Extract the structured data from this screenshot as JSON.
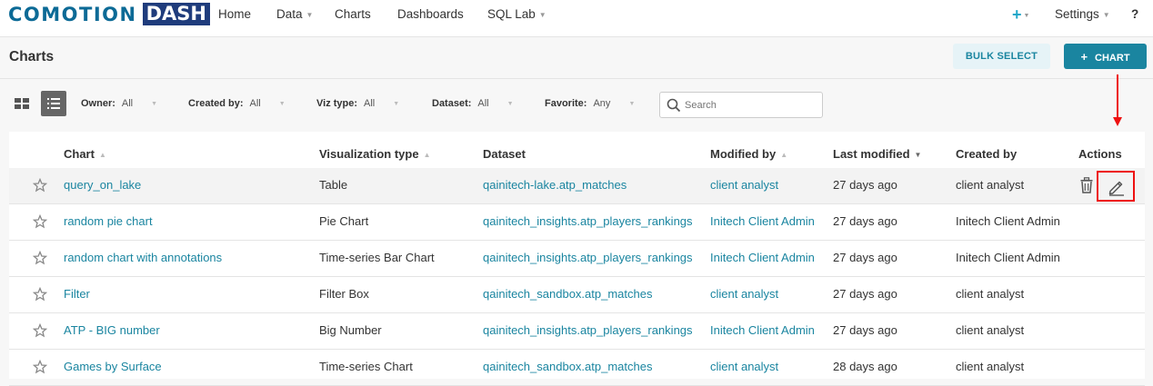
{
  "brand": {
    "logo_left": "COMOTION",
    "logo_right": "DASH"
  },
  "nav": {
    "items": [
      {
        "label": "Home"
      },
      {
        "label": "Data"
      },
      {
        "label": "Charts"
      },
      {
        "label": "Dashboards"
      },
      {
        "label": "SQL Lab"
      }
    ],
    "settings_label": "Settings",
    "help_label": "?"
  },
  "page": {
    "title": "Charts",
    "bulk_select_label": "BULK SELECT",
    "new_chart_label": "CHART"
  },
  "filters": [
    {
      "label": "Owner:",
      "value": "All"
    },
    {
      "label": "Created by:",
      "value": "All"
    },
    {
      "label": "Viz type:",
      "value": "All"
    },
    {
      "label": "Dataset:",
      "value": "All"
    },
    {
      "label": "Favorite:",
      "value": "Any"
    }
  ],
  "search": {
    "placeholder": "Search"
  },
  "table": {
    "columns": [
      "Chart",
      "Visualization type",
      "Dataset",
      "Modified by",
      "Last modified",
      "Created by",
      "Actions"
    ],
    "rows": [
      {
        "chart": "query_on_lake",
        "viz": "Table",
        "dataset": "qainitech-lake.atp_matches",
        "modified_by": "client analyst",
        "last_modified": "27 days ago",
        "created_by": "client analyst"
      },
      {
        "chart": "random pie chart",
        "viz": "Pie Chart",
        "dataset": "qainitech_insights.atp_players_rankings",
        "modified_by": "Initech Client Admin",
        "last_modified": "27 days ago",
        "created_by": "Initech Client Admin"
      },
      {
        "chart": "random chart with annotations",
        "viz": "Time-series Bar Chart",
        "dataset": "qainitech_insights.atp_players_rankings",
        "modified_by": "Initech Client Admin",
        "last_modified": "27 days ago",
        "created_by": "Initech Client Admin"
      },
      {
        "chart": "Filter",
        "viz": "Filter Box",
        "dataset": "qainitech_sandbox.atp_matches",
        "modified_by": "client analyst",
        "last_modified": "27 days ago",
        "created_by": "client analyst"
      },
      {
        "chart": "ATP - BIG number",
        "viz": "Big Number",
        "dataset": "qainitech_insights.atp_players_rankings",
        "modified_by": "Initech Client Admin",
        "last_modified": "27 days ago",
        "created_by": "client analyst"
      },
      {
        "chart": "Games by Surface",
        "viz": "Time-series Chart",
        "dataset": "qainitech_sandbox.atp_matches",
        "modified_by": "client analyst",
        "last_modified": "28 days ago",
        "created_by": "client analyst"
      }
    ]
  },
  "icons": {
    "star": "star-outline-icon",
    "delete": "trash-icon",
    "edit": "pencil-icon",
    "card_view": "grid-icon",
    "list_view": "list-icon",
    "search": "search-icon"
  },
  "colors": {
    "brand_blue": "#0c6a96",
    "brand_red": "#e54d3f",
    "brand_navy": "#1f3c7c",
    "primary": "#1a85a0",
    "highlight_box": "#e11111"
  }
}
